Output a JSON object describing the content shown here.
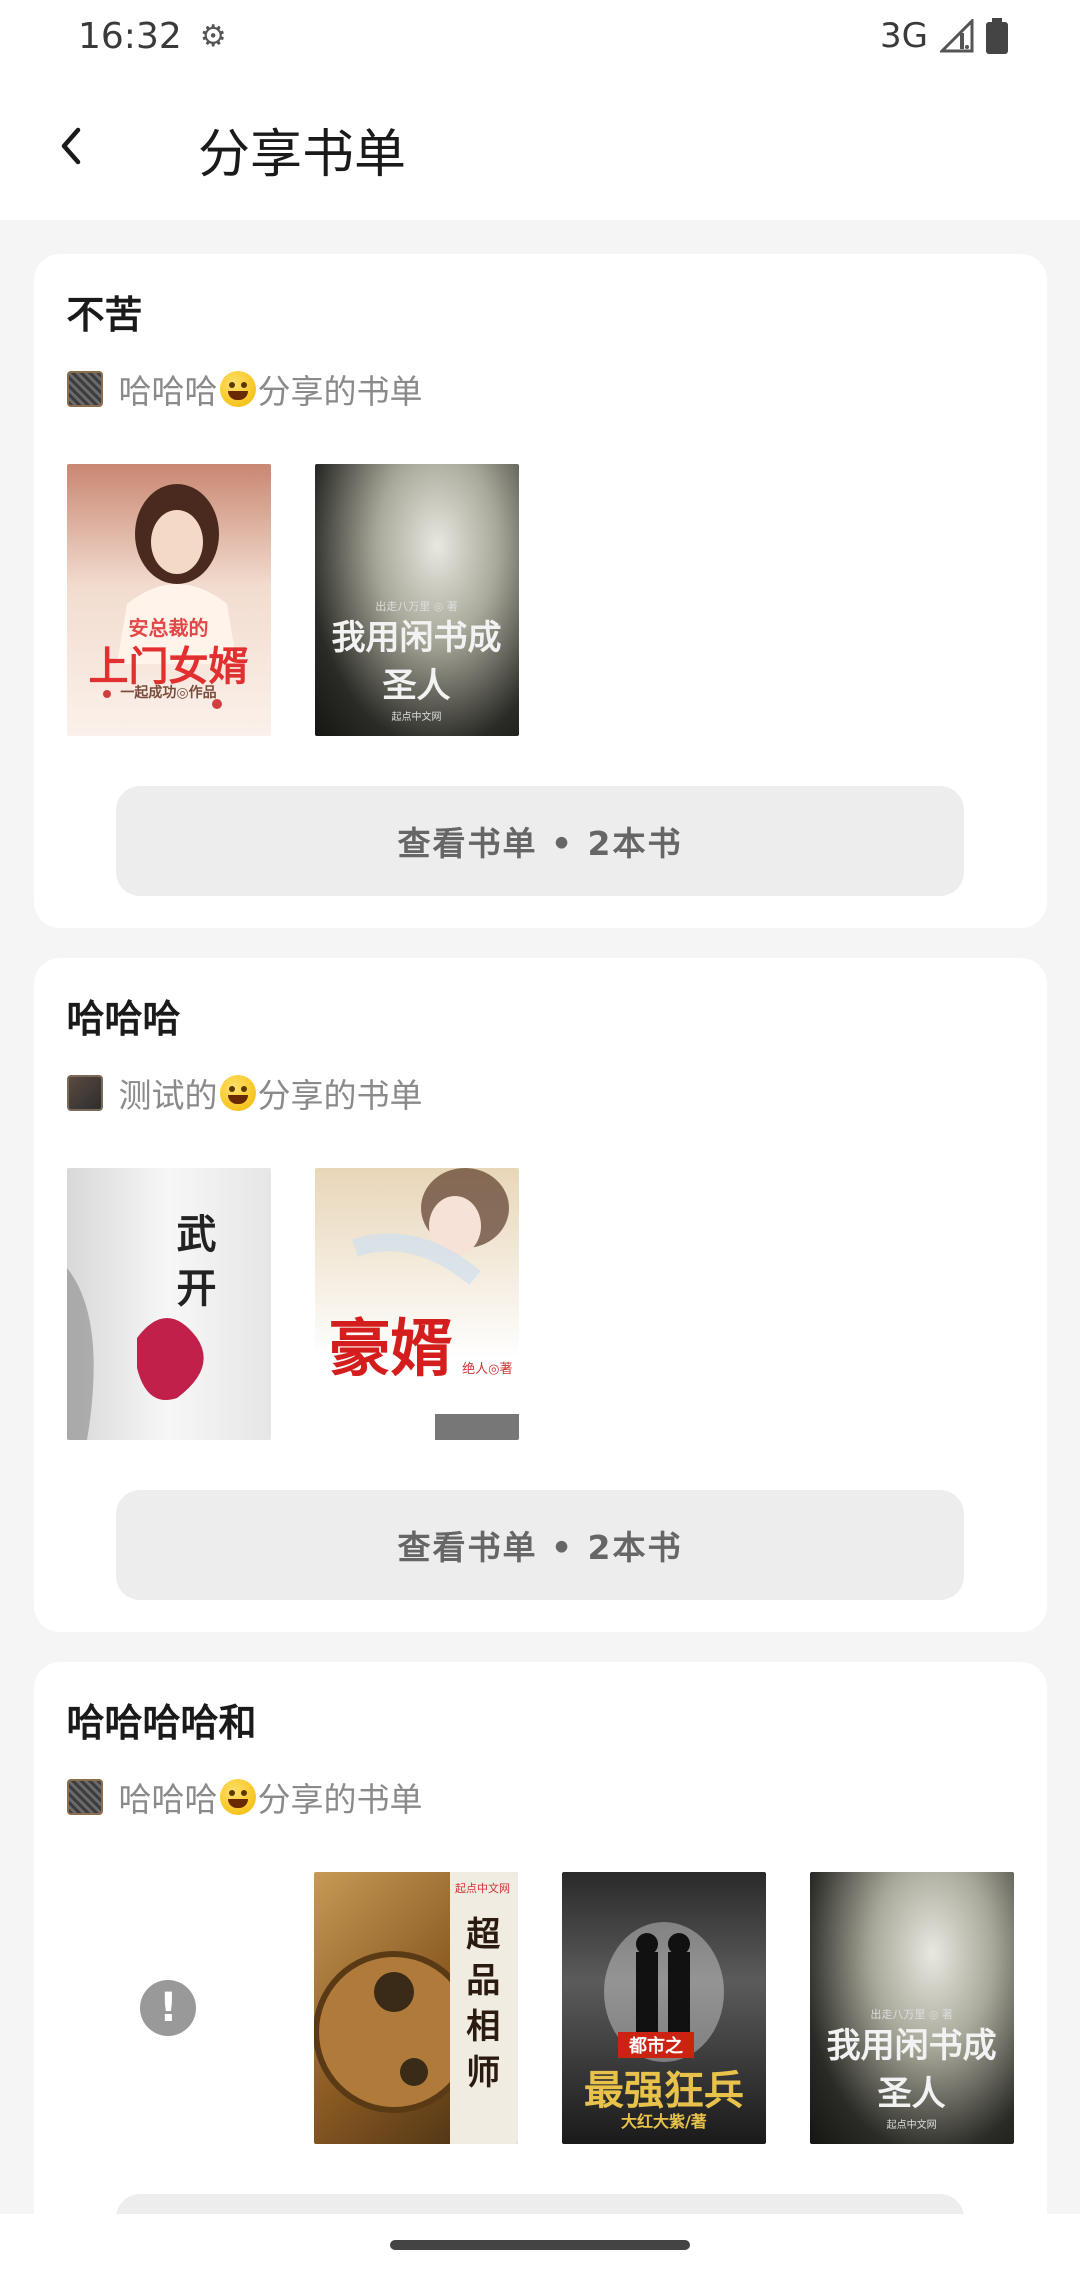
{
  "status_bar": {
    "time": "16:32",
    "network": "3G",
    "icons": [
      "settings-gear-icon",
      "signal-icon",
      "battery-icon"
    ]
  },
  "app_bar": {
    "title": "分享书单",
    "back_icon": "chevron-left-icon"
  },
  "cards": [
    {
      "title": "不苦",
      "sharer": "哈哈哈",
      "sharer_emoji": "rofl-emoji",
      "share_suffix": "分享的书单",
      "books": [
        {
          "cover_text": "上门女婿",
          "cover_top": "安总裁的",
          "cover_author": "一起成功◎作品"
        },
        {
          "cover_text": "我用闲书成圣人",
          "cover_top": "出走八万里 ◎ 著",
          "cover_author": "起点中文网"
        }
      ],
      "button_label": "查看书单 • 2本书"
    },
    {
      "title": "哈哈哈",
      "sharer": "测试的",
      "sharer_emoji": "smile-emoji",
      "share_suffix": "分享的书单",
      "books": [
        {
          "cover_text": "武开",
          "cover_top": "",
          "cover_author": ""
        },
        {
          "cover_text": "豪婿",
          "cover_top": "",
          "cover_author": "绝人◎著"
        }
      ],
      "button_label": "查看书单 • 2本书"
    },
    {
      "title": "哈哈哈哈和",
      "sharer": "哈哈哈",
      "sharer_emoji": "rofl-emoji",
      "share_suffix": "分享的书单",
      "books": [
        {
          "cover_text": "超品相师",
          "cover_top": "起点中文网",
          "cover_author": ""
        },
        {
          "cover_text": "最强狂兵",
          "cover_top": "都市之",
          "cover_author": "大红大紫/著"
        },
        {
          "cover_text": "我用闲书成圣人",
          "cover_top": "出走八万里 ◎ 著",
          "cover_author": "起点中文网"
        }
      ],
      "error_icon": "!",
      "button_label": ""
    }
  ]
}
